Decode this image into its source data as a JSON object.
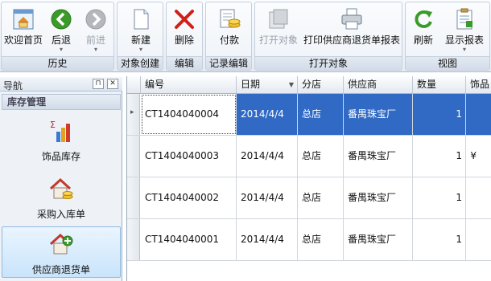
{
  "ribbon": {
    "groups": [
      {
        "caption": "历史"
      },
      {
        "caption": "对象创建"
      },
      {
        "caption": "编辑"
      },
      {
        "caption": "记录编辑"
      },
      {
        "caption": "打开对象"
      },
      {
        "caption": "视图"
      }
    ],
    "buttons": {
      "home": "欢迎首页",
      "back": "后退",
      "forward": "前进",
      "new": "新建",
      "delete": "删除",
      "pay": "付款",
      "open_object": "打开对象",
      "print_report": "打印供应商退货单报表",
      "refresh": "刷新",
      "show_report": "显示报表"
    }
  },
  "nav": {
    "title": "导航",
    "pin_glyph": "⊓",
    "close_glyph": "✕",
    "group": "库存管理",
    "items": [
      {
        "label": "饰品库存",
        "icon": "bar-chart-icon"
      },
      {
        "label": "采购入库单",
        "icon": "house-coins-icon"
      },
      {
        "label": "供应商退货单",
        "icon": "house-add-icon",
        "selected": true
      }
    ]
  },
  "grid": {
    "columns": [
      "编号",
      "日期",
      "分店",
      "供应商",
      "数量",
      "饰品"
    ],
    "sort_glyph": "▼",
    "row_indicator": "▸",
    "rows": [
      {
        "id": "CT1404040004",
        "date": "2014/4/4",
        "branch": "总店",
        "supplier": "番禺珠宝厂",
        "qty": "1",
        "extra": ""
      },
      {
        "id": "CT1404040003",
        "date": "2014/4/4",
        "branch": "总店",
        "supplier": "番禺珠宝厂",
        "qty": "1",
        "extra": "¥"
      },
      {
        "id": "CT1404040002",
        "date": "2014/4/4",
        "branch": "总店",
        "supplier": "番禺珠宝厂",
        "qty": "1",
        "extra": ""
      },
      {
        "id": "CT1404040001",
        "date": "2014/4/4",
        "branch": "总店",
        "supplier": "番禺珠宝厂",
        "qty": "1",
        "extra": ""
      }
    ]
  },
  "colors": {
    "selection": "#316ac5",
    "accent_green": "#3a9a2a",
    "delete_red": "#d0201a"
  }
}
